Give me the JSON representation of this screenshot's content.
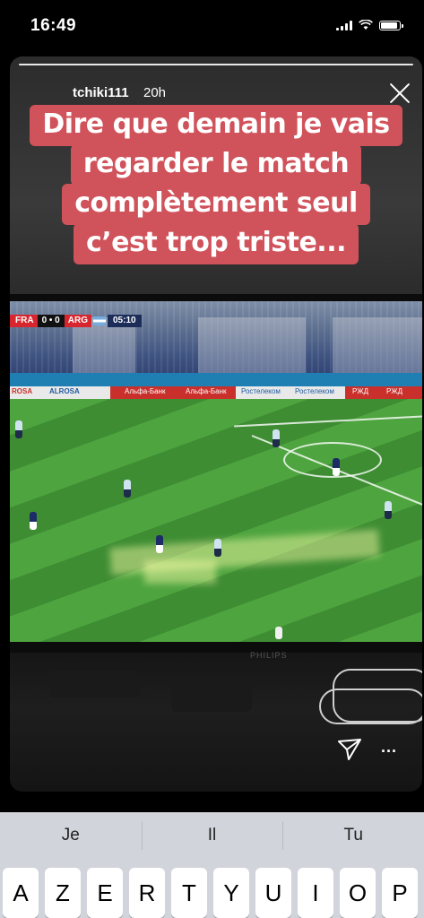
{
  "status_bar": {
    "time": "16:49"
  },
  "story": {
    "username": "tchiki111",
    "timestamp": "20h",
    "progress": 1.0,
    "caption_lines": [
      "Dire que demain je vais",
      "regarder le match",
      "complètement seul",
      "c’est trop triste..."
    ],
    "caption_color": "#d0525a",
    "close_icon": "close-icon",
    "send_icon": "send-icon",
    "more_icon": "more-options-icon",
    "more_label": "..."
  },
  "tv": {
    "brand": "PHILIPS",
    "scoreboard": {
      "home": "FRA",
      "score": "0 • 0",
      "away": "ARG",
      "clock": "05:10"
    },
    "ads": [
      "ROSA",
      "ALROSA",
      "Альфа-Банк",
      "Альфа-Банк",
      "Ростелеком",
      "Ростелеком",
      "РЖД",
      "РЖД"
    ]
  },
  "keyboard": {
    "suggestions": [
      "Je",
      "Il",
      "Tu"
    ],
    "keys": [
      "A",
      "Z",
      "E",
      "R",
      "T",
      "Y",
      "U",
      "I",
      "O",
      "P"
    ]
  }
}
